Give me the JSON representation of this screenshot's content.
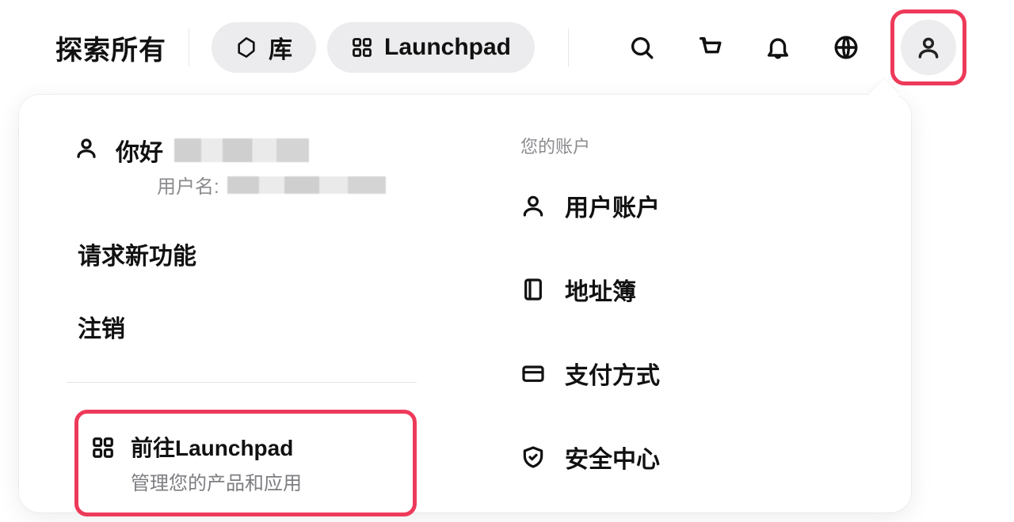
{
  "topbar": {
    "explore_label": "探索所有",
    "pill_library": "库",
    "pill_launchpad": "Launchpad"
  },
  "dropdown": {
    "greeting_prefix": "你好",
    "greeting_name_redacted": true,
    "username_label": "用户名:",
    "username_value_redacted": true,
    "request_feature": "请求新功能",
    "logout": "注销",
    "goto_launchpad_title": "前往Launchpad",
    "goto_launchpad_sub": "管理您的产品和应用"
  },
  "account": {
    "section_label": "您的账户",
    "items": [
      {
        "label": "用户账户",
        "icon": "user-icon"
      },
      {
        "label": "地址簿",
        "icon": "book-icon"
      },
      {
        "label": "支付方式",
        "icon": "card-icon"
      },
      {
        "label": "安全中心",
        "icon": "shield-icon"
      }
    ]
  },
  "highlights": {
    "avatar_button": true,
    "goto_launchpad": true,
    "highlight_color": "#ee3a5a"
  }
}
